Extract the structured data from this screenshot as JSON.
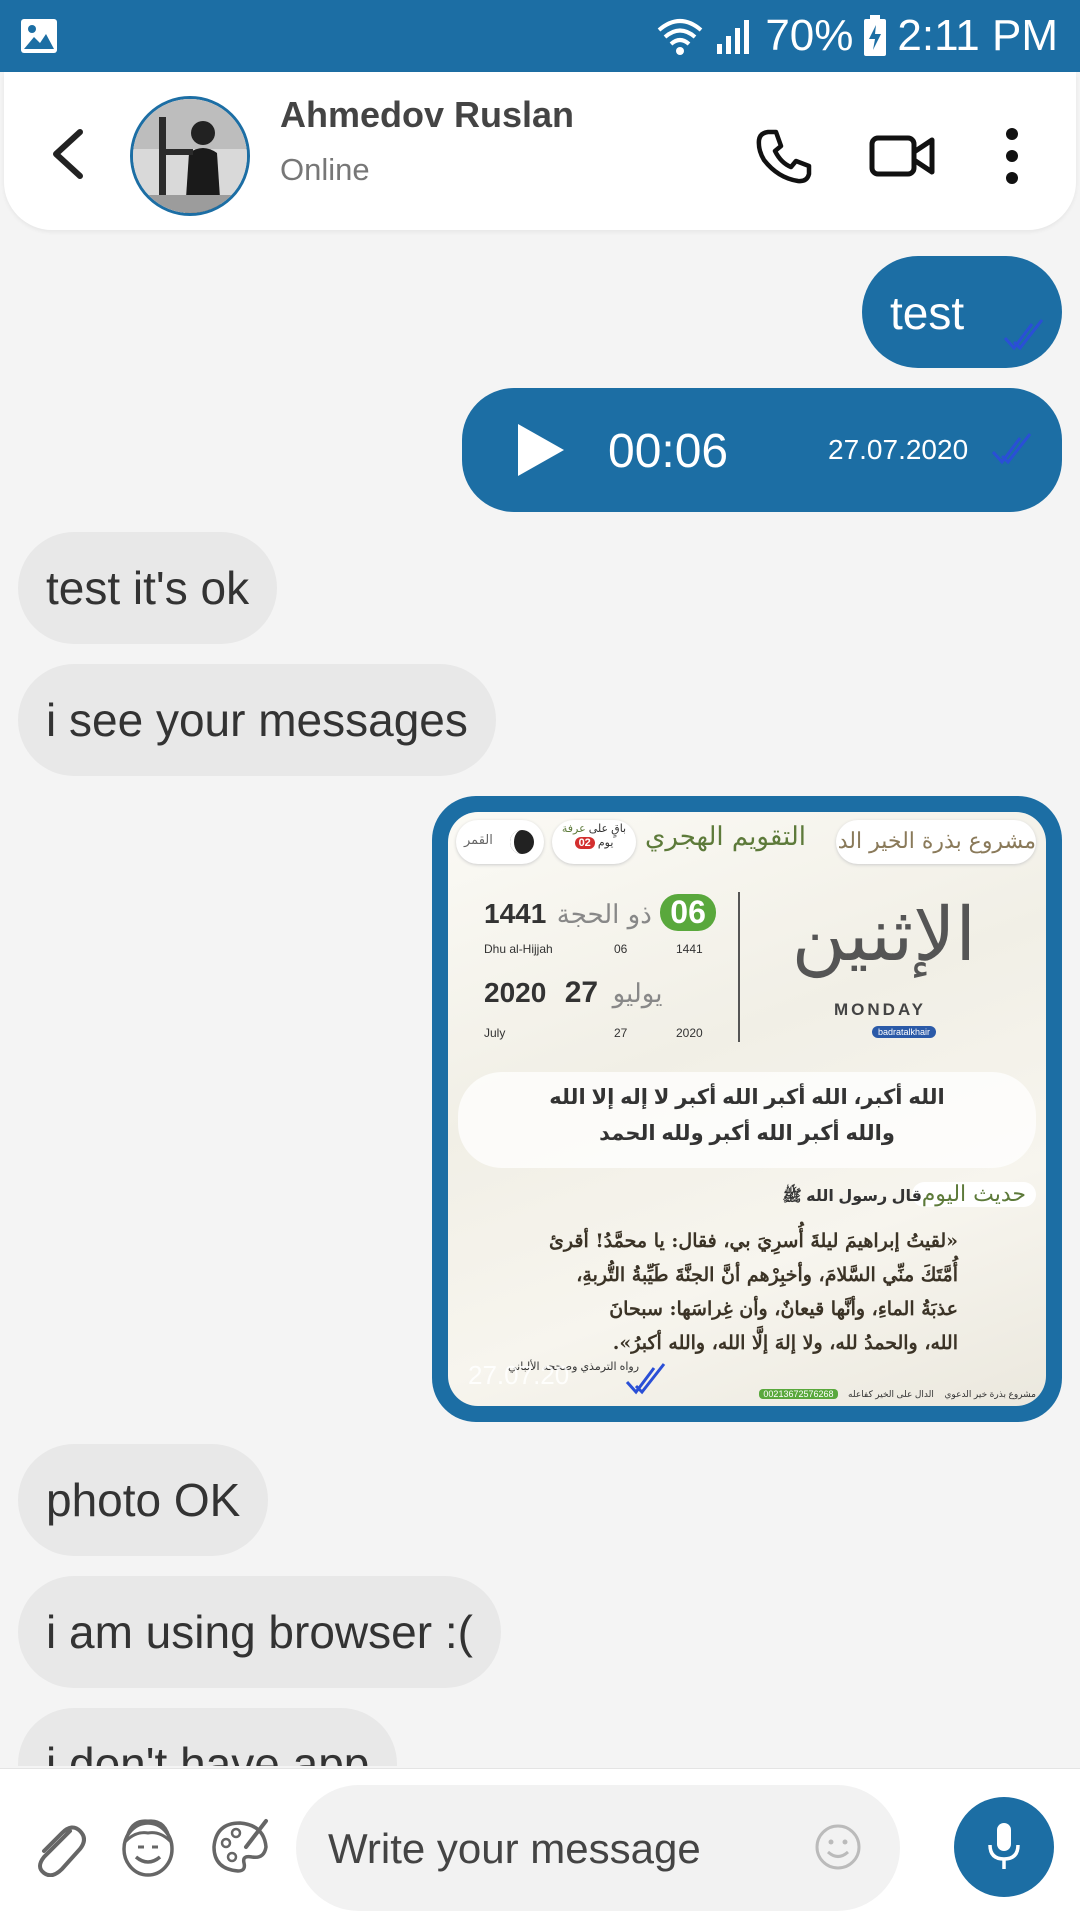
{
  "status_bar": {
    "battery": "70%",
    "time": "2:11 PM"
  },
  "header": {
    "contact_name": "Ahmedov Ruslan",
    "contact_status": "Online"
  },
  "messages": [
    {
      "direction": "out",
      "type": "text",
      "text": "test",
      "read": true
    },
    {
      "direction": "out",
      "type": "voice",
      "duration": "00:06",
      "date": "27.07.2020",
      "read": true
    },
    {
      "direction": "in",
      "type": "text",
      "text": "test it's ok"
    },
    {
      "direction": "in",
      "type": "text",
      "text": "i see your messages"
    },
    {
      "direction": "out",
      "type": "image",
      "date": "27.07.20",
      "read": true,
      "image_text": {
        "project_title": "مشروع بذرة الخير الدعوي",
        "calendar_title": "التقويم الهجري",
        "days_left_prefix": "باقٍ على",
        "days_left_event": "عرفة",
        "days_left_value": "02",
        "days_left_unit": "يوم",
        "moon_label": "القمر",
        "hijri_year": "1441",
        "hijri_month_ar": "ذو الحجة",
        "hijri_day": "06",
        "hijri_month_en": "Dhu al-Hijjah",
        "hijri_day_small": "06",
        "hijri_year_small": "1441",
        "greg_year": "2020",
        "greg_month_ar": "يوليو",
        "greg_day": "27",
        "greg_month_en": "July",
        "greg_day_small": "27",
        "greg_year_small": "2020",
        "weekday_ar": "الإثنين",
        "weekday_en": "MONDAY",
        "social_handle": "badratalkhair",
        "takbir_line1": "الله أكبر، الله أكبر الله أكبر لا إله إلا الله",
        "takbir_line2": "والله أكبر الله أكبر ولله الحمد",
        "hadith_title": "حديث اليوم",
        "hadith_intro": "قال رسول الله ﷺ",
        "hadith_line1": "«لقيتُ إبراهيمَ ليلةَ أُسرِيَ بي، فقال: يا محمَّدُ! أقرئ",
        "hadith_line2": "أُمَّتَكَ منِّي السَّلامَ، وأخبِرْهم أنَّ الجنَّةَ طَيِّبةُ التُّربةِ،",
        "hadith_line3": "عذبَةُ الماءِ، وأنَّها قيعانٌ، وأن غِراسَها: سبحانَ",
        "hadith_line4": "الله، والحمدُ لله، ولا إلهَ إلَّا الله، والله أكبرُ».",
        "hadith_source": "رواه الترمذي وصححه الألباني",
        "footer_project": "مشروع بذرة خير الدعوي",
        "footer_slogan": "الدال على الخير كفاعله",
        "footer_phone": "00213672576268"
      }
    },
    {
      "direction": "in",
      "type": "text",
      "text": "photo OK"
    },
    {
      "direction": "in",
      "type": "text",
      "text": "i am using browser :("
    },
    {
      "direction": "in",
      "type": "text",
      "text": "i don't have app"
    }
  ],
  "composer": {
    "placeholder": "Write your message"
  },
  "colors": {
    "primary": "#1c6ea4",
    "incoming_bubble": "#e8e8e8",
    "background": "#f4f4f4",
    "read_check": "#2a4fd6"
  },
  "icons": {
    "status": [
      "gallery-icon",
      "wifi-icon",
      "signal-icon",
      "battery-icon"
    ],
    "header": [
      "back-arrow-icon",
      "phone-icon",
      "video-camera-icon",
      "more-vertical-icon"
    ],
    "composer": [
      "paperclip-icon",
      "face-icon",
      "palette-icon",
      "smiley-icon",
      "microphone-icon"
    ]
  }
}
